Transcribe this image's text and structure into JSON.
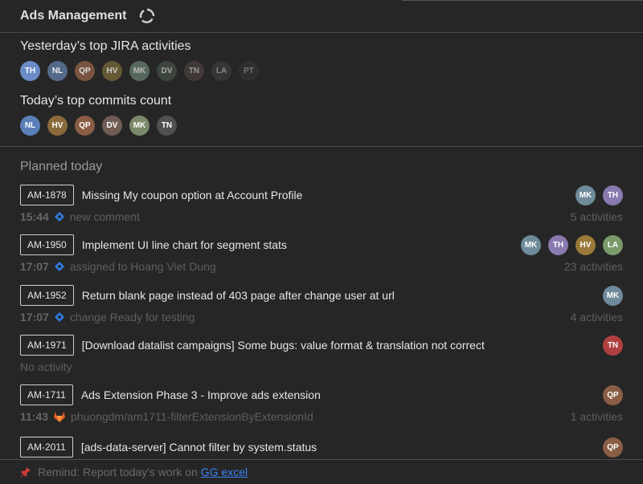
{
  "header": {
    "title": "Ads Management",
    "sync_icon": "sync-icon"
  },
  "jira_section": {
    "title": "Yesterday’s top JIRA activities",
    "avatars": [
      {
        "initials": "TH",
        "color": "#6b8cc7"
      },
      {
        "initials": "NL",
        "color": "#5a6f93"
      },
      {
        "initials": "QP",
        "color": "#8a5d45"
      },
      {
        "initials": "HV",
        "color": "#7a6a3a"
      },
      {
        "initials": "MK",
        "color": "#6f8a7a"
      },
      {
        "initials": "DV",
        "color": "#4c5a4c"
      },
      {
        "initials": "TN",
        "color": "#5a4a4a"
      },
      {
        "initials": "LA",
        "color": "#494c45"
      },
      {
        "initials": "PT",
        "color": "#3f3f3f"
      }
    ]
  },
  "commits_section": {
    "title": "Today’s top commits count",
    "avatars": [
      {
        "initials": "NL",
        "color": "#5a7fb8"
      },
      {
        "initials": "HV",
        "color": "#8a6a3a"
      },
      {
        "initials": "QP",
        "color": "#8a5d45"
      },
      {
        "initials": "DV",
        "color": "#6f5d55"
      },
      {
        "initials": "MK",
        "color": "#7a8a6a"
      },
      {
        "initials": "TN",
        "color": "#505050"
      }
    ]
  },
  "planned": {
    "title": "Planned today",
    "tasks": [
      {
        "key": "AM-1878",
        "summary": "Missing My coupon option at Account Profile",
        "time": "15:44",
        "source": "jira",
        "activity": "new comment",
        "count": "5 activities",
        "avatars": [
          {
            "initials": "MK",
            "color": "#6f8a9a"
          },
          {
            "initials": "TH",
            "color": "#8a7ab0"
          }
        ]
      },
      {
        "key": "AM-1950",
        "summary": "Implement UI line chart for segment stats",
        "time": "17:07",
        "source": "jira",
        "activity": "assigned to Hoang Viet Dung",
        "count": "23 activities",
        "avatars": [
          {
            "initials": "MK",
            "color": "#6f8a9a"
          },
          {
            "initials": "TH",
            "color": "#8a7ab0"
          },
          {
            "initials": "HV",
            "color": "#9a7a3a"
          },
          {
            "initials": "LA",
            "color": "#7a9a6a"
          }
        ]
      },
      {
        "key": "AM-1952",
        "summary": "Return blank page instead of 403 page after change user at url",
        "time": "17:07",
        "source": "jira",
        "activity": "change Ready for testing",
        "count": "4 activities",
        "avatars": [
          {
            "initials": "MK",
            "color": "#6f8a9a"
          }
        ]
      },
      {
        "key": "AM-1971",
        "summary": "[Download datalist campaigns] Some bugs: value format & translation not correct",
        "time": "",
        "source": "",
        "activity": "No activity",
        "count": "",
        "avatars": [
          {
            "initials": "TN",
            "color": "#b04040"
          }
        ]
      },
      {
        "key": "AM-1711",
        "summary": "Ads Extension Phase 3 - Improve ads extension",
        "time": "11:43",
        "source": "gitlab",
        "activity": "phuongdm/am1711-filterExtensionByExtensionId",
        "count": "1 activities",
        "avatars": [
          {
            "initials": "QP",
            "color": "#8a5d45"
          }
        ]
      },
      {
        "key": "AM-2011",
        "summary": "[ads-data-server] Cannot filter by system.status",
        "time": "",
        "source": "",
        "activity": "",
        "count": "",
        "avatars": [
          {
            "initials": "QP",
            "color": "#8a5d45"
          }
        ]
      }
    ]
  },
  "footer": {
    "text": "Remind: Report today's work on",
    "link": "GG excel",
    "icon": "pin-icon"
  }
}
